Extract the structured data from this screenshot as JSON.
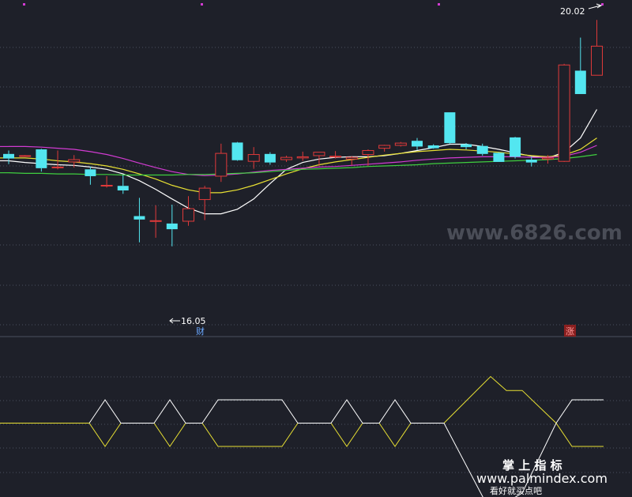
{
  "colors": {
    "background": "#1e2029",
    "grid": "#4a4f5e",
    "up": "#e03a3a",
    "down": "#53e6f0",
    "ma_white": "#ffffff",
    "ma_yellow": "#e8e033",
    "ma_magenta": "#d23bd2",
    "ma_green": "#3fcf3f",
    "osc_yellow": "#e8e033",
    "osc_white": "#ffffff",
    "watermark": "#4a4d57",
    "tag_blue": "#6aa8ff",
    "tag_red_bg": "#8a1f1f"
  },
  "chart_data": [
    {
      "type": "candlestick",
      "ylim": [
        14.55,
        20.3
      ],
      "x": [
        1,
        2,
        3,
        4,
        5,
        6,
        7,
        8,
        9,
        10,
        11,
        12,
        13,
        14,
        15,
        16,
        17,
        18,
        19,
        20,
        21,
        22,
        23,
        24,
        25,
        26,
        27,
        28,
        29,
        30,
        31,
        32,
        33,
        34,
        35,
        36,
        37
      ],
      "candles": [
        {
          "o": 17.67,
          "h": 17.73,
          "l": 17.49,
          "c": 17.59
        },
        {
          "o": 17.63,
          "h": 17.65,
          "l": 17.63,
          "c": 17.64
        },
        {
          "o": 17.75,
          "h": 17.76,
          "l": 17.36,
          "c": 17.42
        },
        {
          "o": 17.44,
          "h": 17.73,
          "l": 17.4,
          "c": 17.44
        },
        {
          "o": 17.53,
          "h": 17.65,
          "l": 17.43,
          "c": 17.57
        },
        {
          "o": 17.4,
          "h": 17.45,
          "l": 17.13,
          "c": 17.28
        },
        {
          "o": 17.12,
          "h": 17.28,
          "l": 17.08,
          "c": 17.12
        },
        {
          "o": 17.11,
          "h": 17.3,
          "l": 16.97,
          "c": 17.03
        },
        {
          "o": 16.58,
          "h": 16.9,
          "l": 16.12,
          "c": 16.52
        },
        {
          "o": 16.49,
          "h": 16.77,
          "l": 16.2,
          "c": 16.5
        },
        {
          "o": 16.45,
          "h": 16.78,
          "l": 16.05,
          "c": 16.35
        },
        {
          "o": 16.49,
          "h": 16.93,
          "l": 16.41,
          "c": 16.71
        },
        {
          "o": 16.87,
          "h": 17.11,
          "l": 16.51,
          "c": 17.07
        },
        {
          "o": 17.28,
          "h": 17.85,
          "l": 17.18,
          "c": 17.68
        },
        {
          "o": 17.87,
          "h": 17.88,
          "l": 17.55,
          "c": 17.56
        },
        {
          "o": 17.54,
          "h": 17.79,
          "l": 17.41,
          "c": 17.66
        },
        {
          "o": 17.67,
          "h": 17.7,
          "l": 17.48,
          "c": 17.52
        },
        {
          "o": 17.57,
          "h": 17.64,
          "l": 17.53,
          "c": 17.61
        },
        {
          "o": 17.6,
          "h": 17.71,
          "l": 17.55,
          "c": 17.62
        },
        {
          "o": 17.64,
          "h": 17.7,
          "l": 17.46,
          "c": 17.7
        },
        {
          "o": 17.62,
          "h": 17.72,
          "l": 17.59,
          "c": 17.63
        },
        {
          "o": 17.58,
          "h": 17.63,
          "l": 17.47,
          "c": 17.61
        },
        {
          "o": 17.66,
          "h": 17.75,
          "l": 17.46,
          "c": 17.73
        },
        {
          "o": 17.77,
          "h": 17.83,
          "l": 17.71,
          "c": 17.82
        },
        {
          "o": 17.82,
          "h": 17.88,
          "l": 17.8,
          "c": 17.86
        },
        {
          "o": 17.9,
          "h": 17.95,
          "l": 17.74,
          "c": 17.8
        },
        {
          "o": 17.82,
          "h": 17.84,
          "l": 17.76,
          "c": 17.77
        },
        {
          "o": 18.4,
          "h": 18.4,
          "l": 17.85,
          "c": 17.86
        },
        {
          "o": 17.84,
          "h": 17.86,
          "l": 17.75,
          "c": 17.79
        },
        {
          "o": 17.81,
          "h": 17.85,
          "l": 17.64,
          "c": 17.67
        },
        {
          "o": 17.69,
          "h": 17.7,
          "l": 17.53,
          "c": 17.53
        },
        {
          "o": 17.96,
          "h": 17.97,
          "l": 17.59,
          "c": 17.62
        },
        {
          "o": 17.57,
          "h": 17.62,
          "l": 17.45,
          "c": 17.52
        },
        {
          "o": 17.58,
          "h": 17.65,
          "l": 17.5,
          "c": 17.6
        },
        {
          "o": 17.54,
          "h": 19.25,
          "l": 17.53,
          "c": 19.23
        },
        {
          "o": 19.13,
          "h": 19.71,
          "l": 18.72,
          "c": 18.72
        },
        {
          "o": 19.05,
          "h": 20.02,
          "l": 19.05,
          "c": 19.56
        }
      ],
      "moving_averages": [
        {
          "color_key": "ma_white",
          "values": [
            17.55,
            17.52,
            17.5,
            17.48,
            17.47,
            17.44,
            17.4,
            17.32,
            17.2,
            17.05,
            16.88,
            16.72,
            16.62,
            16.62,
            16.7,
            16.88,
            17.15,
            17.4,
            17.52,
            17.58,
            17.61,
            17.62,
            17.62,
            17.64,
            17.68,
            17.73,
            17.78,
            17.84,
            17.84,
            17.8,
            17.75,
            17.69,
            17.63,
            17.6,
            17.7,
            17.95,
            18.45
          ]
        },
        {
          "color_key": "ma_yellow",
          "values": [
            17.6,
            17.6,
            17.58,
            17.55,
            17.53,
            17.5,
            17.46,
            17.4,
            17.32,
            17.23,
            17.12,
            17.04,
            16.99,
            16.99,
            17.04,
            17.12,
            17.22,
            17.32,
            17.41,
            17.48,
            17.53,
            17.57,
            17.61,
            17.65,
            17.68,
            17.71,
            17.73,
            17.75,
            17.74,
            17.72,
            17.7,
            17.67,
            17.64,
            17.62,
            17.65,
            17.75,
            17.95
          ]
        },
        {
          "color_key": "ma_magenta",
          "values": [
            17.8,
            17.8,
            17.79,
            17.77,
            17.75,
            17.71,
            17.66,
            17.59,
            17.51,
            17.43,
            17.36,
            17.31,
            17.29,
            17.3,
            17.32,
            17.35,
            17.38,
            17.4,
            17.42,
            17.44,
            17.45,
            17.47,
            17.49,
            17.51,
            17.53,
            17.56,
            17.58,
            17.6,
            17.61,
            17.62,
            17.62,
            17.62,
            17.61,
            17.61,
            17.63,
            17.7,
            17.82
          ]
        },
        {
          "color_key": "ma_green",
          "values": [
            17.34,
            17.33,
            17.33,
            17.32,
            17.32,
            17.31,
            17.31,
            17.3,
            17.3,
            17.3,
            17.3,
            17.31,
            17.31,
            17.32,
            17.33,
            17.34,
            17.36,
            17.38,
            17.4,
            17.41,
            17.42,
            17.43,
            17.45,
            17.46,
            17.47,
            17.48,
            17.5,
            17.51,
            17.52,
            17.53,
            17.54,
            17.55,
            17.56,
            17.57,
            17.59,
            17.62,
            17.66
          ]
        }
      ],
      "annotations": [
        {
          "text": "20.02",
          "x": 37,
          "y": 20.02
        },
        {
          "text": "16.05",
          "x": 11,
          "y": 16.05
        }
      ],
      "markers": [
        {
          "text": "财",
          "x": 13
        },
        {
          "text": "涨",
          "x": 36
        }
      ]
    },
    {
      "type": "line",
      "ylim": [
        0,
        100
      ],
      "series": [
        {
          "color_key": "osc_yellow",
          "points": [
            [
              0,
              25
            ],
            [
              113,
              25
            ],
            [
              133,
              0
            ],
            [
              153,
              25
            ],
            [
              195,
              25
            ],
            [
              215,
              0
            ],
            [
              235,
              25
            ],
            [
              256,
              25
            ],
            [
              276,
              0
            ],
            [
              357,
              0
            ],
            [
              377,
              25
            ],
            [
              419,
              25
            ],
            [
              439,
              0
            ],
            [
              459,
              25
            ],
            [
              480,
              25
            ],
            [
              500,
              0
            ],
            [
              520,
              25
            ],
            [
              562,
              25
            ],
            [
              621,
              75
            ],
            [
              641,
              60
            ],
            [
              661,
              60
            ],
            [
              704,
              25
            ],
            [
              724,
              0
            ],
            [
              764,
              0
            ]
          ]
        },
        {
          "color_key": "osc_white",
          "points": [
            [
              113,
              25
            ],
            [
              133,
              50
            ],
            [
              153,
              25
            ],
            [
              195,
              25
            ],
            [
              215,
              50
            ],
            [
              235,
              25
            ],
            [
              256,
              25
            ],
            [
              276,
              50
            ],
            [
              357,
              50
            ],
            [
              377,
              25
            ],
            [
              419,
              25
            ],
            [
              439,
              50
            ],
            [
              459,
              25
            ],
            [
              480,
              25
            ],
            [
              500,
              50
            ],
            [
              520,
              25
            ],
            [
              562,
              25
            ],
            [
              621,
              -70
            ],
            [
              641,
              -60
            ],
            [
              661,
              -50
            ],
            [
              704,
              25
            ],
            [
              724,
              50
            ],
            [
              764,
              50
            ]
          ]
        }
      ]
    }
  ],
  "labels": {
    "low_price": "16.05",
    "high_price": "20.02",
    "tag_left": "财",
    "tag_right": "涨",
    "watermark": "www.6826.com",
    "bottom_text": "看好就买点吧",
    "brand_cn": "掌 上 指 标",
    "brand_url": "www.palmindex.com"
  }
}
